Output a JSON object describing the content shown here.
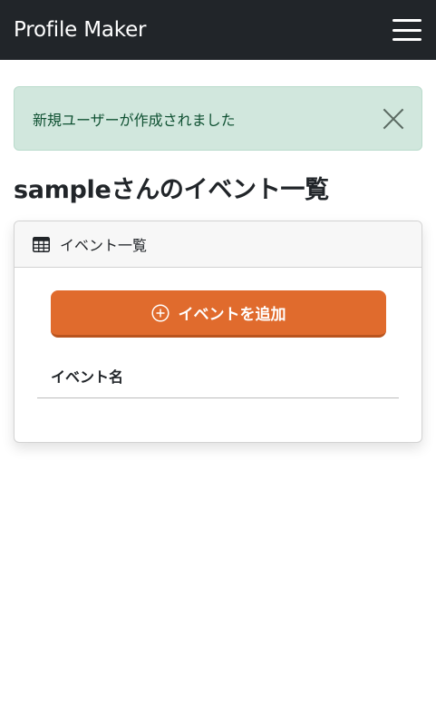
{
  "navbar": {
    "brand": "Profile Maker",
    "menu_icon": "hamburger-icon"
  },
  "alert": {
    "message": "新規ユーザーが作成されました",
    "close_icon": "close-icon",
    "color": "#d1e7dd"
  },
  "page": {
    "title": "sampleさんのイベント一覧"
  },
  "card": {
    "header_icon": "table-icon",
    "header_title": "イベント一覧",
    "add_button": {
      "icon": "plus-circle-icon",
      "label": "イベントを追加",
      "color": "#e06b2d"
    },
    "table": {
      "columns": [
        "イベント名"
      ],
      "rows": []
    }
  }
}
